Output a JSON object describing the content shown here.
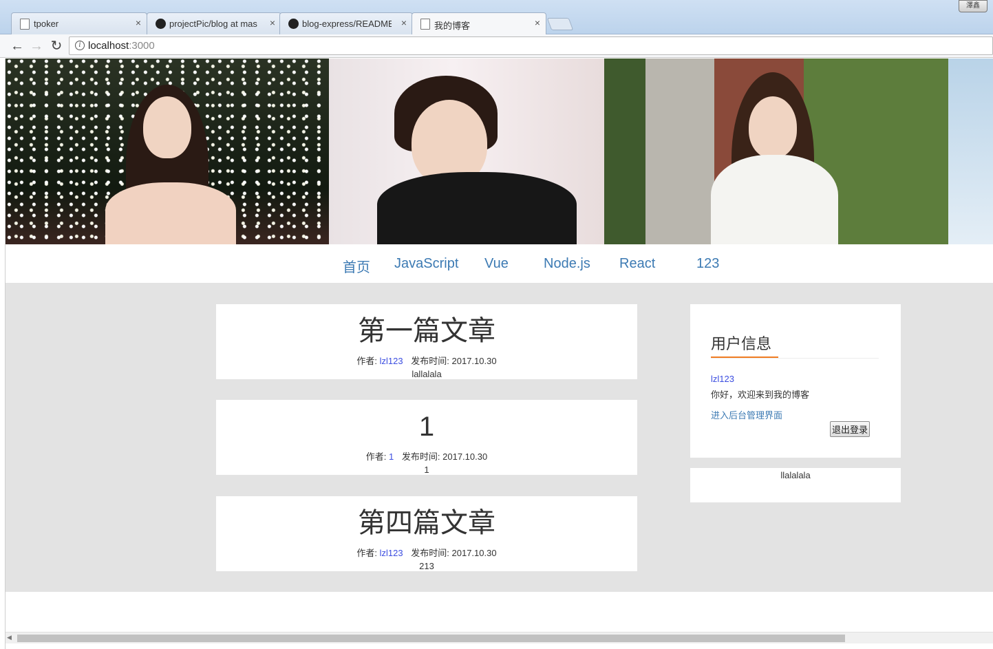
{
  "browser": {
    "tabs": [
      {
        "label": "tpoker",
        "icon": "page-icon",
        "active": false
      },
      {
        "label": "projectPic/blog at mas",
        "icon": "github-icon",
        "active": false
      },
      {
        "label": "blog-express/README",
        "icon": "github-icon",
        "active": false
      },
      {
        "label": "我的博客",
        "icon": "page-icon",
        "active": true
      }
    ],
    "tab_close": "×",
    "window_button": "澤鑫",
    "back": "←",
    "forward": "→",
    "reload": "↻",
    "info_icon": "i",
    "url_host": "localhost",
    "url_port": ":3000"
  },
  "nav": {
    "items": [
      "首页",
      "JavaScript",
      "Vue",
      "Node.js",
      "React",
      "123"
    ],
    "link_color": "#3c7ab3"
  },
  "articles": [
    {
      "title": "第一篇文章",
      "author_label": "作者:",
      "author": "lzl123",
      "date_label": "发布时间:",
      "date": "2017.10.30",
      "excerpt": "lallalala"
    },
    {
      "title": "1",
      "author_label": "作者:",
      "author": "1",
      "date_label": "发布时间:",
      "date": "2017.10.30",
      "excerpt": "1"
    },
    {
      "title": "第四篇文章",
      "author_label": "作者:",
      "author": "lzl123",
      "date_label": "发布时间:",
      "date": "2017.10.30",
      "excerpt": "213"
    }
  ],
  "sidebar": {
    "heading": "用户信息",
    "username": "lzl123",
    "welcome": "你好，欢迎来到我的博客",
    "admin_link": "进入后台管理界面",
    "logout": "退出登录",
    "note": "llalalala",
    "accent_color": "#f07c22"
  },
  "scrollbar": {
    "left_arrow": "◀"
  }
}
